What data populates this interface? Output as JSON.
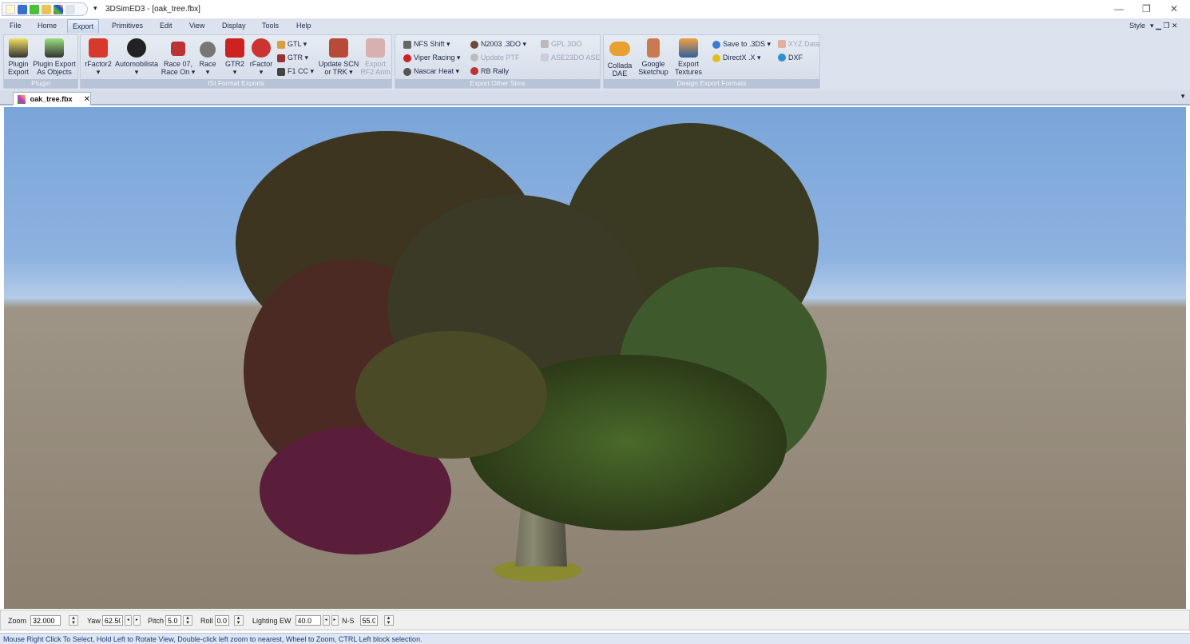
{
  "window": {
    "title": "3DSimED3 - [oak_tree.fbx]",
    "style_label": "Style"
  },
  "menu": {
    "tabs": [
      "File",
      "Home",
      "Export",
      "Primitives",
      "Edit",
      "View",
      "Display",
      "Tools",
      "Help"
    ],
    "active": "Export"
  },
  "ribbon": {
    "plugin": {
      "label": "Plugin",
      "plugin_export": "Plugin\nExport",
      "plugin_export_objects": "Plugin Export\nAs Objects"
    },
    "isi": {
      "label": "ISI Format Exports",
      "rfactor2": "rFactor2",
      "automobilista": "Automobilista",
      "race07": "Race 07,\nRace On ▾",
      "race": "Race",
      "gtr2": "GTR2",
      "rfactor": "rFactor",
      "gtl": "GTL ▾",
      "gtr": "GTR ▾",
      "f1cc": "F1 CC ▾",
      "update_scn": "Update SCN\nor TRK ▾",
      "export_rf2_anm": "Export\nRF2 Anm"
    },
    "other": {
      "label": "Export Other Sims",
      "nfs_shift": "NFS Shift ▾",
      "viper_racing": "Viper Racing ▾",
      "nascar_heat": "Nascar Heat ▾",
      "n2003": "N2003 .3DO ▾",
      "update_ptf": "Update PTF",
      "rb_rally": "RB Rally",
      "gpl_3do": "GPL 3DO",
      "ase23do": "ASE23DO ASE"
    },
    "design": {
      "label": "Design Export Formats",
      "collada": "Collada\nDAE",
      "google_sketchup": "Google\nSketchup",
      "export_textures": "Export\nTextures",
      "save_3ds": "Save to .3DS ▾",
      "directx": "DirectX .X ▾",
      "xyz_data": "XYZ Data",
      "dxf": "DXF"
    }
  },
  "document_tab": {
    "label": "oak_tree.fbx"
  },
  "controls": {
    "zoom_label": "Zoom",
    "zoom": "32.000",
    "yaw_label": "Yaw",
    "yaw": "62.500",
    "pitch_label": "Pitch",
    "pitch": "5.0",
    "roll_label": "Roll",
    "roll": "0.0",
    "lighting_ew_label": "Lighting EW",
    "lighting_ew": "40.0",
    "ns_label": "N-S",
    "ns": "55.0"
  },
  "status": "Mouse Right Click To Select, Hold Left to Rotate View, Double-click left  zoom to nearest, Wheel to Zoom, CTRL Left block selection."
}
